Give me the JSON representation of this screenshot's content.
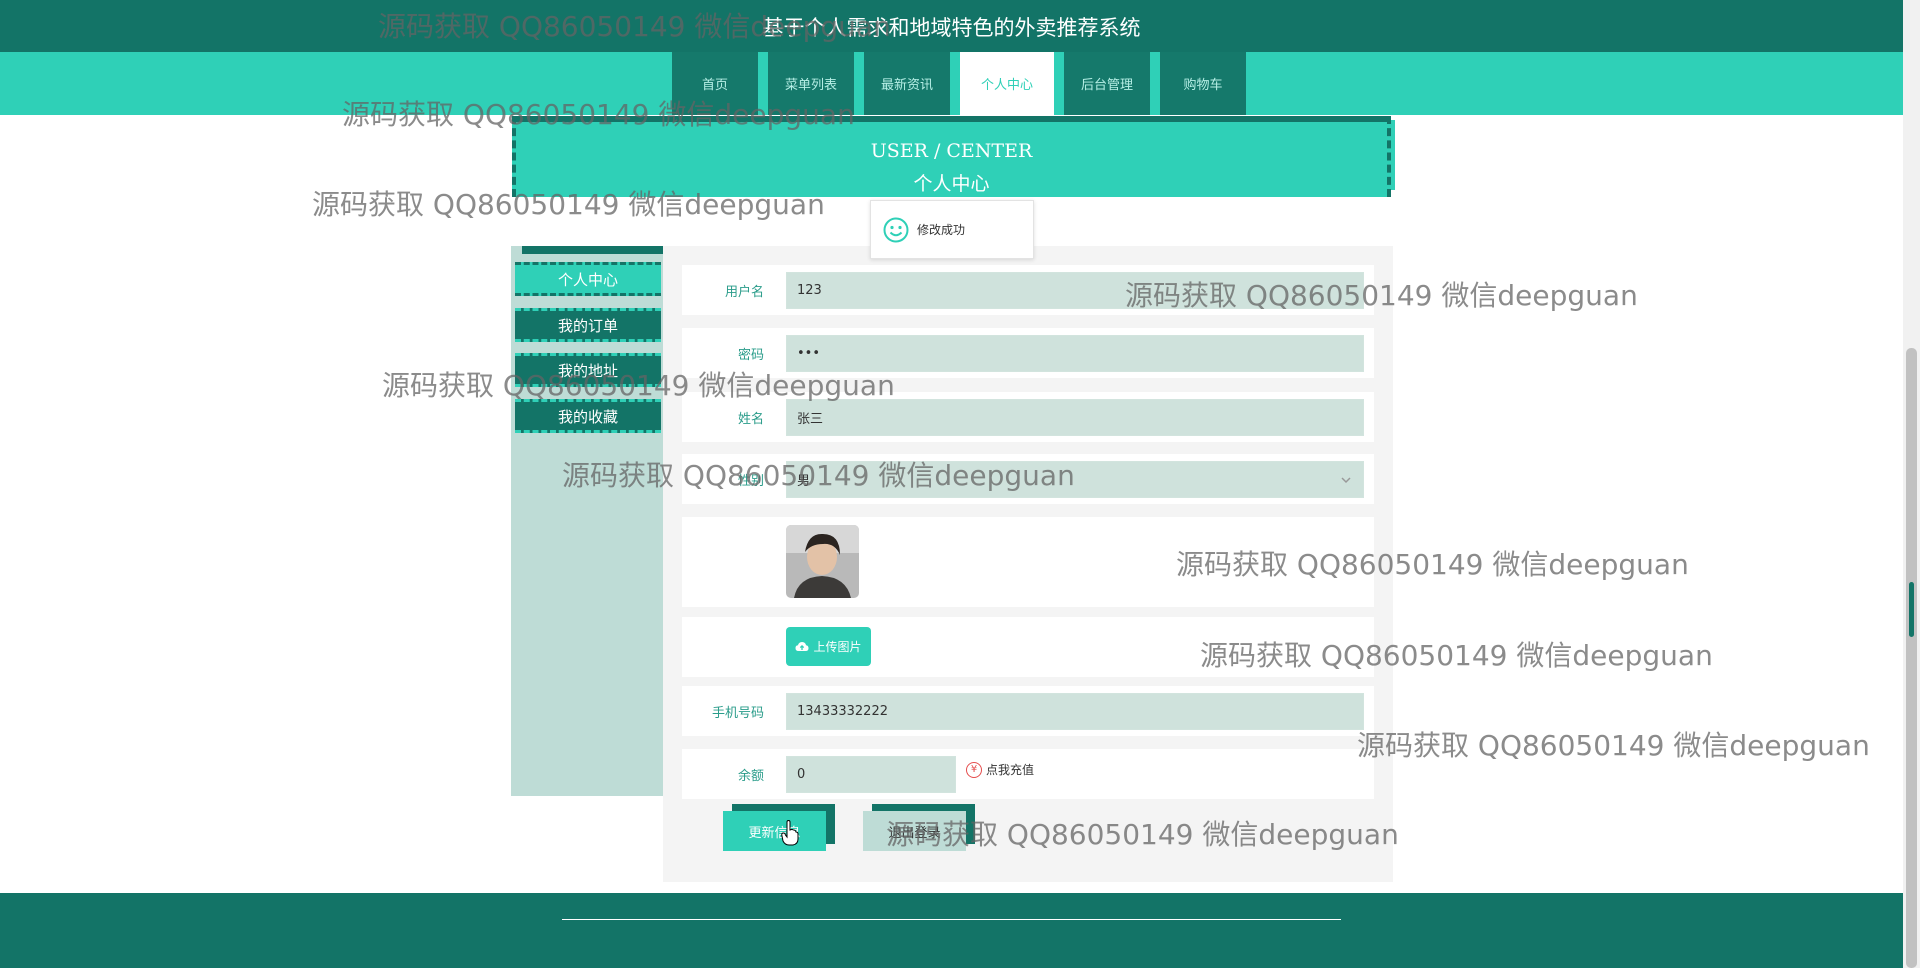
{
  "site": {
    "title": "基于个人需求和地域特色的外卖推荐系统"
  },
  "nav": {
    "items": [
      {
        "label": "首页"
      },
      {
        "label": "菜单列表"
      },
      {
        "label": "最新资讯"
      },
      {
        "label": "个人中心"
      },
      {
        "label": "后台管理"
      },
      {
        "label": "购物车"
      }
    ],
    "active": "个人中心"
  },
  "banner": {
    "en": "USER / CENTER",
    "cn": "个人中心"
  },
  "toast": {
    "text": "修改成功",
    "icon": "smile-icon"
  },
  "sidebar": {
    "items": [
      {
        "label": "个人中心"
      },
      {
        "label": "我的订单"
      },
      {
        "label": "我的地址"
      },
      {
        "label": "我的收藏"
      }
    ]
  },
  "form": {
    "username": {
      "label": "用户名",
      "value": "123"
    },
    "password": {
      "label": "密码",
      "value": "•••"
    },
    "name": {
      "label": "姓名",
      "value": "张三"
    },
    "gender": {
      "label": "性别",
      "value": "男"
    },
    "upload_label": "上传图片",
    "phone": {
      "label": "手机号码",
      "value": "13433332222"
    },
    "balance": {
      "label": "余额",
      "value": "0"
    },
    "recharge_label": "点我充值",
    "update_label": "更新信息",
    "logout_label": "退出登录"
  },
  "watermark": "源码获取 QQ86050149 微信deepguan",
  "colors": {
    "primary": "#2fd0b7",
    "dark": "#137467",
    "field": "#cfe2dc"
  }
}
